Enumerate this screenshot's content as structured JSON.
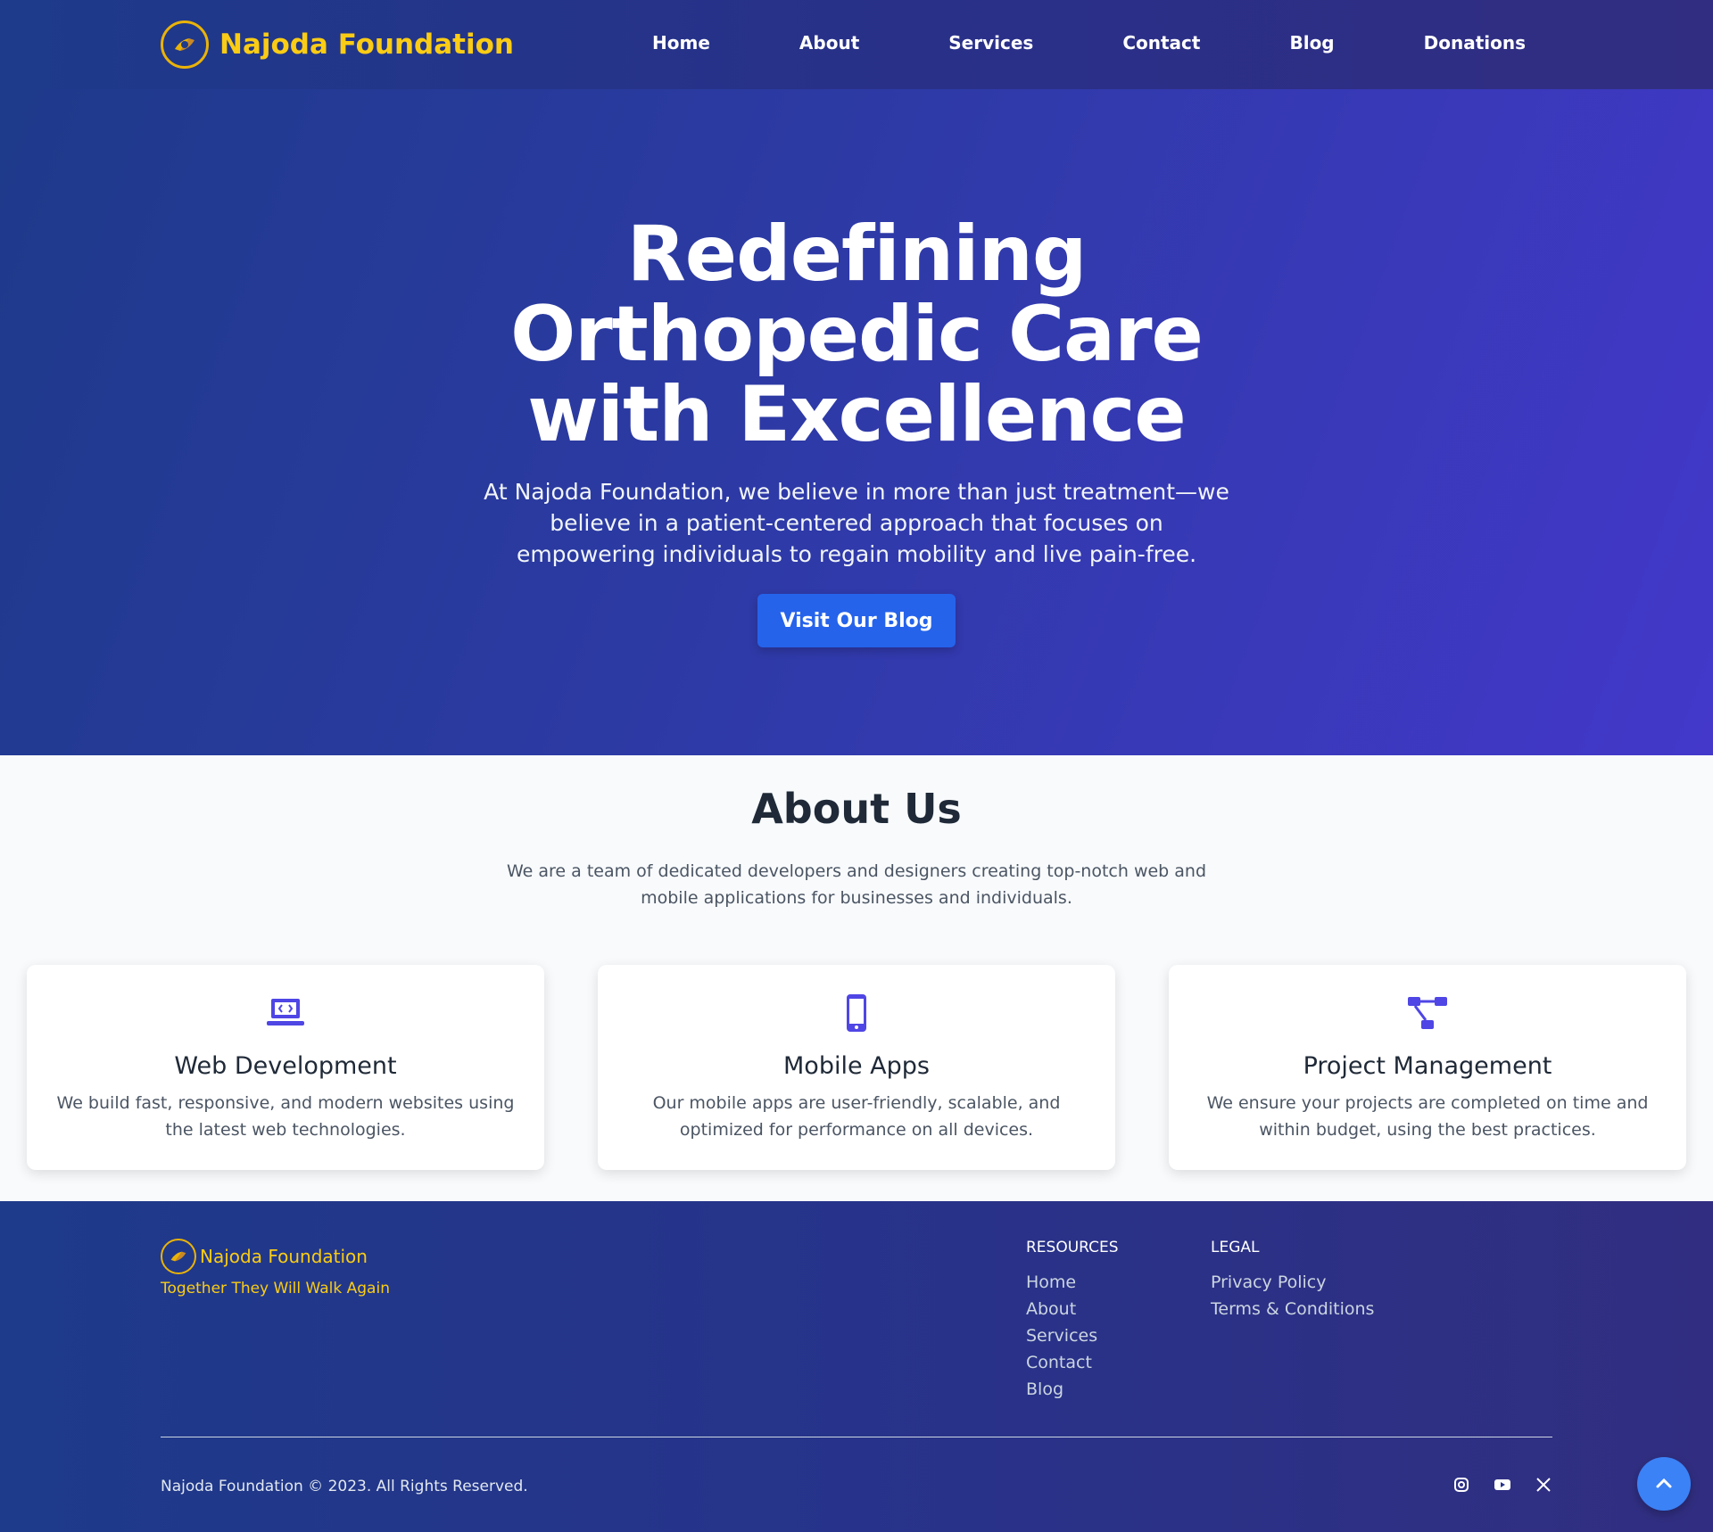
{
  "header": {
    "brand": "Najoda Foundation",
    "nav": [
      "Home",
      "About",
      "Services",
      "Contact",
      "Blog",
      "Donations"
    ]
  },
  "hero": {
    "title_line1": "Redefining",
    "title_line2": "Orthopedic Care",
    "title_line3": "with Excellence",
    "text": "At Najoda Foundation, we believe in more than just treatment—we believe in a patient-centered approach that focuses on empowering individuals to regain mobility and live pain-free.",
    "button": "Visit Our Blog"
  },
  "about": {
    "title": "About Us",
    "text": "We are a team of dedicated developers and designers creating top-notch web and mobile applications for businesses and individuals.",
    "cards": [
      {
        "icon": "laptop-code-icon",
        "title": "Web Development",
        "text": "We build fast, responsive, and modern websites using the latest web technologies."
      },
      {
        "icon": "mobile-phone-icon",
        "title": "Mobile Apps",
        "text": "Our mobile apps are user-friendly, scalable, and optimized for performance on all devices."
      },
      {
        "icon": "project-diagram-icon",
        "title": "Project Management",
        "text": "We ensure your projects are completed on time and within budget, using the best practices."
      }
    ]
  },
  "footer": {
    "brand": "Najoda Foundation",
    "tagline": "Together They Will Walk Again",
    "resources": {
      "heading": "RESOURCES",
      "links": [
        "Home",
        "About",
        "Services",
        "Contact",
        "Blog"
      ]
    },
    "legal": {
      "heading": "LEGAL",
      "links": [
        "Privacy Policy",
        "Terms & Conditions"
      ]
    },
    "copyright": "Najoda Foundation © 2023. All Rights Reserved.",
    "social": [
      "instagram-icon",
      "youtube-icon",
      "x-twitter-icon"
    ]
  },
  "colors": {
    "brand_yellow": "#facc15",
    "primary_blue": "#2563eb",
    "icon_indigo": "#4f46e5"
  }
}
